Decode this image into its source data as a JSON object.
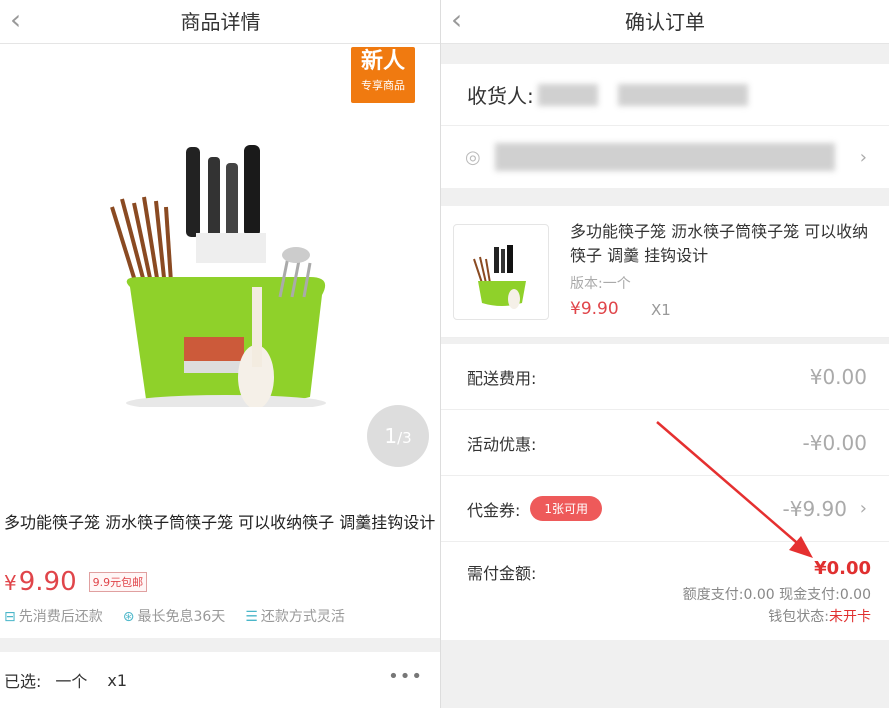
{
  "left": {
    "header": {
      "back_icon": "chevron-left-icon",
      "title": "商品详情"
    },
    "badge": {
      "line1": "新人",
      "line2": "专享商品"
    },
    "image_counter": {
      "current": "1",
      "total": "/3"
    },
    "product": {
      "title": "多功能筷子笼 沥水筷子筒筷子笼 可以收纳筷子 调羹挂钩设计",
      "currency": "¥",
      "price": "9.90",
      "shipping_tag": "9.9元包邮"
    },
    "features": [
      {
        "icon": "calendar-icon",
        "label": "先消费后还款"
      },
      {
        "icon": "interest-icon",
        "label": "最长免息36天"
      },
      {
        "icon": "coins-icon",
        "label": "还款方式灵活"
      }
    ],
    "selected": {
      "label": "已选:",
      "variant": "一个",
      "qty": "x1",
      "more_icon": "more-dots-icon"
    }
  },
  "right": {
    "header": {
      "back_icon": "chevron-left-icon",
      "title": "确认订单"
    },
    "address": {
      "name_label": "收货人:"
    },
    "goods": {
      "title": "多功能筷子笼 沥水筷子筒筷子笼 可以收纳筷子 调羹 挂钩设计",
      "version": "版本:一个",
      "price": "¥9.90",
      "qty": "X1"
    },
    "rows": [
      {
        "label": "配送费用:",
        "value": "¥0.00"
      },
      {
        "label": "活动优惠:",
        "value": "-¥0.00"
      },
      {
        "label": "代金券:",
        "badge": "1张可用",
        "value": "-¥9.90"
      }
    ],
    "payment": {
      "label": "需付金额:",
      "amount": "¥0.00",
      "breakdown": "额度支付:0.00  现金支付:0.00",
      "wallet_label": "钱包状态:",
      "wallet_status": "未开卡"
    }
  },
  "colors": {
    "price_red": "#e0454a",
    "badge_orange": "#f07a10",
    "coupon_red": "#ee5a5a",
    "feature_teal": "#4ab6c9"
  }
}
